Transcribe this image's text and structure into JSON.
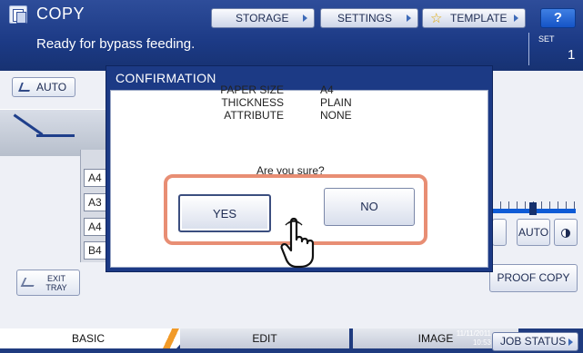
{
  "header": {
    "app_title": "COPY",
    "status_message": "Ready for bypass feeding.",
    "buttons": {
      "storage": "STORAGE",
      "settings": "SETTINGS",
      "template": "TEMPLATE",
      "help": "?"
    },
    "set_label": "SET",
    "set_value": "1"
  },
  "left_panel": {
    "auto_label": "AUTO",
    "trays": [
      "A4",
      "A3",
      "A4",
      "B4"
    ],
    "exit_tray_label_line1": "EXIT",
    "exit_tray_label_line2": "TRAY"
  },
  "right_panel": {
    "auto_label": "AUTO",
    "proof_copy_label": "PROOF COPY"
  },
  "dialog": {
    "title": "CONFIRMATION",
    "rows": [
      {
        "key": "PAPER SIZE",
        "value": "A4"
      },
      {
        "key": "THICKNESS",
        "value": "PLAIN"
      },
      {
        "key": "ATTRIBUTE",
        "value": "NONE"
      }
    ],
    "question": "Are you sure?",
    "yes_label": "YES",
    "no_label": "NO"
  },
  "tabs": {
    "basic": "BASIC",
    "edit": "EDIT",
    "image": "IMAGE"
  },
  "footer": {
    "date": "11/11/2011",
    "time": "10:53",
    "job_status": "JOB STATUS"
  },
  "colors": {
    "header_blue": "#1c3a85",
    "highlight": "#e88e74",
    "tab_accent": "#f19a28",
    "slider_blue": "#0f5bd6"
  }
}
